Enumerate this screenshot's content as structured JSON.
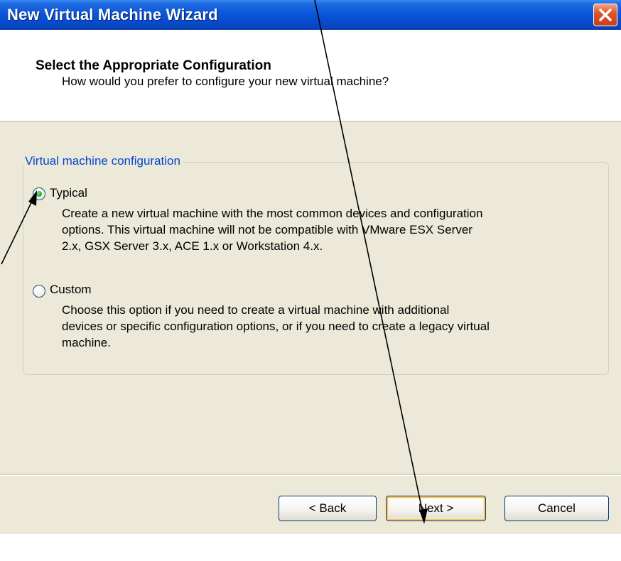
{
  "window": {
    "title": "New Virtual Machine Wizard",
    "close_icon": "close-icon"
  },
  "header": {
    "title": "Select the Appropriate Configuration",
    "subtitle": "How would you prefer to configure your new virtual machine?"
  },
  "config_group": {
    "legend": "Virtual machine configuration",
    "options": [
      {
        "label": "Typical",
        "selected": true,
        "description": [
          "Create a new virtual machine with the most common devices and configuration",
          "options. This virtual machine will not be compatible with VMware ESX Server",
          "2.x, GSX Server 3.x, ACE 1.x or Workstation 4.x."
        ]
      },
      {
        "label": "Custom",
        "selected": false,
        "description": [
          "Choose this option if you need to create a virtual machine with additional",
          "devices or specific configuration options, or if you need to create a legacy virtual",
          "machine."
        ]
      }
    ]
  },
  "buttons": {
    "back": "< Back",
    "next": "Next >",
    "cancel": "Cancel"
  },
  "colors": {
    "titlebar": "#0a54d8",
    "dialog_bg": "#ece9d8",
    "legend_text": "#0046d5",
    "radio_selected": "#21a121",
    "close_button": "#e0562c",
    "default_button_ring": "#f8c46a"
  }
}
